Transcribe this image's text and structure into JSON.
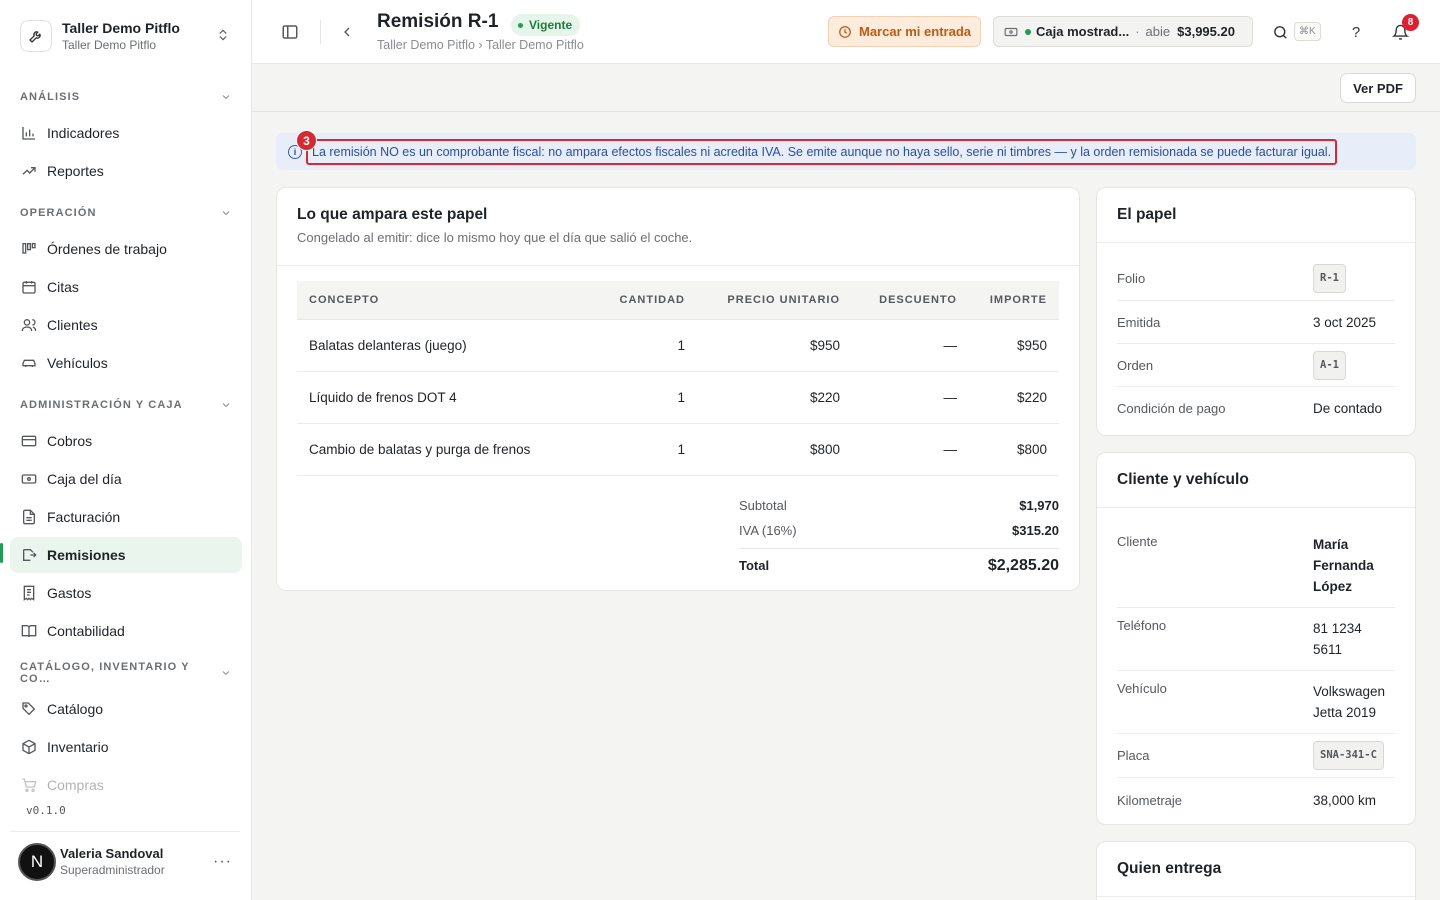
{
  "org": {
    "name": "Taller Demo Pitflo",
    "sub": "Taller Demo Pitflo"
  },
  "sidebar": {
    "sections": [
      {
        "title": "ANÁLISIS",
        "items": [
          {
            "label": "Indicadores",
            "icon": "bar-chart-icon"
          },
          {
            "label": "Reportes",
            "icon": "trending-up-icon"
          }
        ]
      },
      {
        "title": "OPERACIÓN",
        "items": [
          {
            "label": "Órdenes de trabajo",
            "icon": "kanban-icon"
          },
          {
            "label": "Citas",
            "icon": "calendar-icon"
          },
          {
            "label": "Clientes",
            "icon": "users-icon"
          },
          {
            "label": "Vehículos",
            "icon": "car-icon"
          }
        ]
      },
      {
        "title": "ADMINISTRACIÓN Y CAJA",
        "items": [
          {
            "label": "Cobros",
            "icon": "credit-card-icon"
          },
          {
            "label": "Caja del día",
            "icon": "banknote-icon"
          },
          {
            "label": "Facturación",
            "icon": "file-text-icon"
          },
          {
            "label": "Remisiones",
            "icon": "file-export-icon",
            "active": true
          },
          {
            "label": "Gastos",
            "icon": "receipt-icon"
          },
          {
            "label": "Contabilidad",
            "icon": "book-icon"
          }
        ]
      },
      {
        "title": "CATÁLOGO, INVENTARIO Y CO…",
        "items": [
          {
            "label": "Catálogo",
            "icon": "tag-icon"
          },
          {
            "label": "Inventario",
            "icon": "box-icon"
          },
          {
            "label": "Compras",
            "icon": "cart-icon"
          }
        ]
      }
    ],
    "version": "v0.1.0",
    "user": {
      "initial": "N",
      "name": "Valeria Sandoval",
      "role": "Superadministrador"
    }
  },
  "header": {
    "title": "Remisión R-1",
    "status": "Vigente",
    "breadcrumb": "Taller Demo Pitflo › Taller Demo Pitflo",
    "entrada_label": "Marcar mi entrada",
    "caja": {
      "name": "Caja mostrad...",
      "sep": "·",
      "state": "abie",
      "amount": "$3,995.20"
    },
    "search_kbd": "⌘K",
    "notifications": "8"
  },
  "actions": {
    "pdf_label": "Ver PDF"
  },
  "banner": {
    "marker": "3",
    "text": "La remisión NO es un comprobante fiscal: no ampara efectos fiscales ni acredita IVA. Se emite aunque no haya sello, serie ni timbres — y la orden remisionada se puede facturar igual."
  },
  "items_card": {
    "title": "Lo que ampara este papel",
    "subtitle": "Congelado al emitir: dice lo mismo hoy que el día que salió el coche.",
    "columns": [
      "CONCEPTO",
      "CANTIDAD",
      "PRECIO UNITARIO",
      "DESCUENTO",
      "IMPORTE"
    ],
    "rows": [
      [
        "Balatas delanteras (juego)",
        "1",
        "$950",
        "—",
        "$950"
      ],
      [
        "Líquido de frenos DOT 4",
        "1",
        "$220",
        "—",
        "$220"
      ],
      [
        "Cambio de balatas y purga de frenos",
        "1",
        "$800",
        "—",
        "$800"
      ]
    ],
    "totals": {
      "subtotal_label": "Subtotal",
      "subtotal": "$1,970",
      "iva_label": "IVA (16%)",
      "iva": "$315.20",
      "total_label": "Total",
      "total": "$2,285.20"
    }
  },
  "paper_card": {
    "title": "El papel",
    "folio_label": "Folio",
    "folio": "R-1",
    "emitida_label": "Emitida",
    "emitida": "3 oct 2025",
    "orden_label": "Orden",
    "orden": "A-1",
    "condicion_label": "Condición de pago",
    "condicion": "De contado"
  },
  "client_card": {
    "title": "Cliente y vehículo",
    "cliente_label": "Cliente",
    "cliente": "María Fernanda López",
    "telefono_label": "Teléfono",
    "telefono": "81 1234 5611",
    "vehiculo_label": "Vehículo",
    "vehiculo": "Volkswagen Jetta 2019",
    "placa_label": "Placa",
    "placa": "SNA-341-C",
    "km_label": "Kilometraje",
    "km": "38,000 km"
  },
  "delivery_card": {
    "title": "Quien entrega"
  },
  "colors": {
    "accent": "#1f9d55",
    "warning": "#c05a13",
    "info": "#2b4fa0",
    "alert": "#d9282f"
  }
}
